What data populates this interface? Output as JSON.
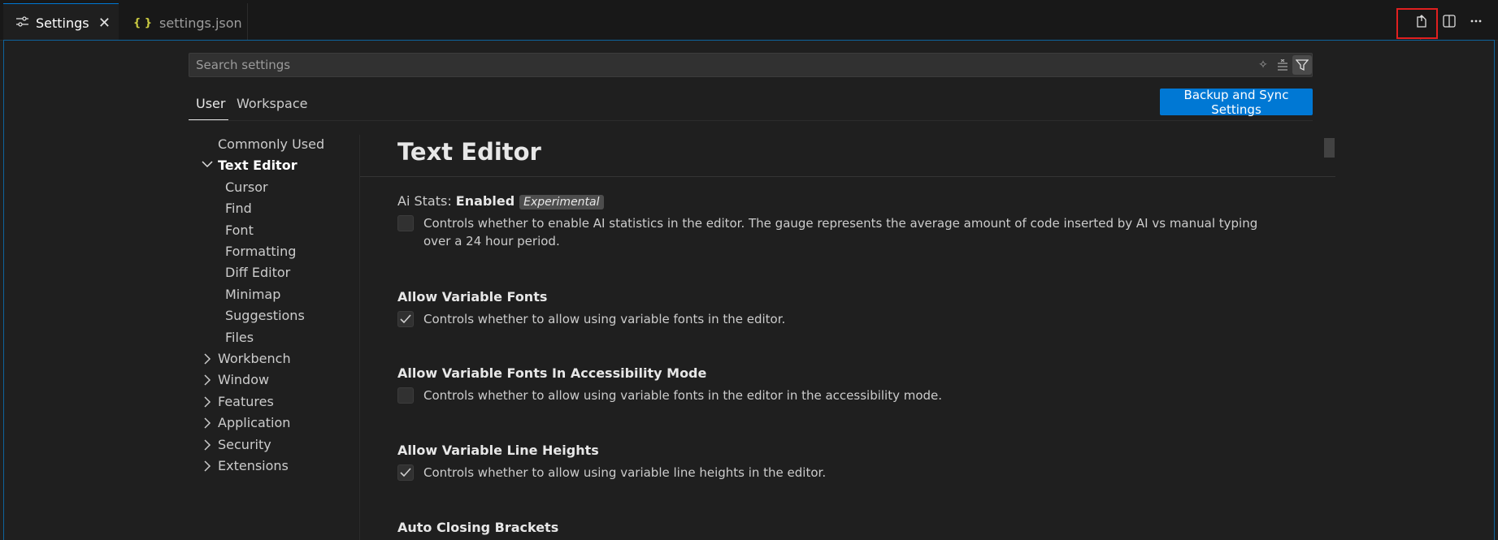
{
  "tabs": {
    "settings": {
      "label": "Settings",
      "icon": "settings-sliders-icon"
    },
    "settings_json": {
      "label": "settings.json",
      "icon": "json-braces-icon",
      "icon_text": "{ }"
    }
  },
  "actions": [
    "open-settings-json-icon",
    "split-editor-icon",
    "more-actions-icon"
  ],
  "search": {
    "placeholder": "Search settings"
  },
  "scope": {
    "user": "User",
    "workspace": "Workspace"
  },
  "sync_button": "Backup and Sync Settings",
  "toc": {
    "commonly_used": "Commonly Used",
    "text_editor": "Text Editor",
    "cursor": "Cursor",
    "find": "Find",
    "font": "Font",
    "formatting": "Formatting",
    "diff_editor": "Diff Editor",
    "minimap": "Minimap",
    "suggestions": "Suggestions",
    "files": "Files",
    "workbench": "Workbench",
    "window": "Window",
    "features": "Features",
    "application": "Application",
    "security": "Security",
    "extensions": "Extensions"
  },
  "section_title": "Text Editor",
  "settings": {
    "ai_stats": {
      "prefix": "Ai Stats: ",
      "title": "Enabled",
      "badge": "Experimental",
      "checked": false,
      "desc": "Controls whether to enable AI statistics in the editor. The gauge represents the average amount of code inserted by AI vs manual typing over a 24 hour period."
    },
    "variable_fonts": {
      "title": "Allow Variable Fonts",
      "checked": true,
      "desc": "Controls whether to allow using variable fonts in the editor."
    },
    "variable_fonts_a11y": {
      "title": "Allow Variable Fonts In Accessibility Mode",
      "checked": false,
      "desc": "Controls whether to allow using variable fonts in the editor in the accessibility mode."
    },
    "variable_line_heights": {
      "title": "Allow Variable Line Heights",
      "checked": true,
      "desc": "Controls whether to allow using variable line heights in the editor."
    },
    "auto_closing_brackets": {
      "title": "Auto Closing Brackets"
    }
  },
  "colors": {
    "accent": "#0078d4",
    "annotation": "#e02020"
  }
}
